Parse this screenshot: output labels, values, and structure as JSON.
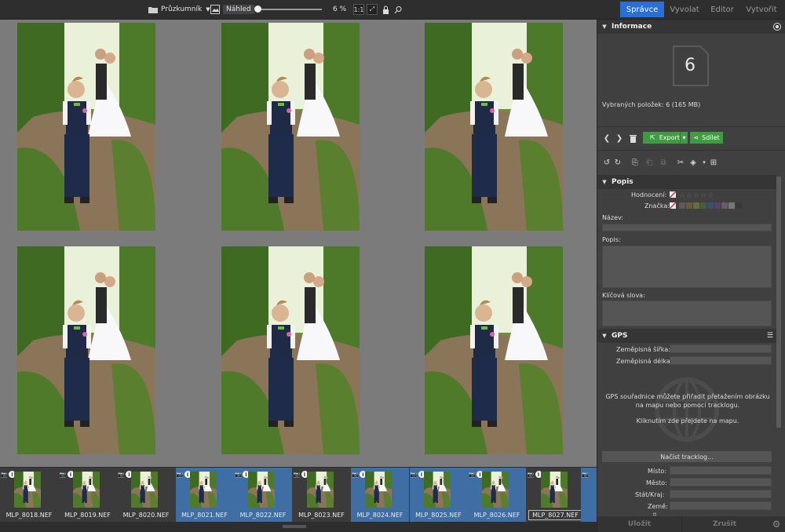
{
  "toolbar": {
    "explorer_label": "Průzkumník",
    "preview_label": "Náhled",
    "zoom_value": "6 %",
    "zoom_fraction": 0.05
  },
  "mode_tabs": [
    {
      "label": "Správce",
      "active": true
    },
    {
      "label": "Vyvolat",
      "active": false
    },
    {
      "label": "Editor",
      "active": false
    },
    {
      "label": "Vytvořit",
      "active": false
    }
  ],
  "filmstrip": [
    {
      "name": "MLP_8018.NEF",
      "selected": false
    },
    {
      "name": "MLP_8019.NEF",
      "selected": false
    },
    {
      "name": "MLP_8020.NEF",
      "selected": false
    },
    {
      "name": "MLP_8021.NEF",
      "selected": true
    },
    {
      "name": "MLP_8022.NEF",
      "selected": true
    },
    {
      "name": "MLP_8023.NEF",
      "selected": false
    },
    {
      "name": "MLP_8024.NEF",
      "selected": true
    },
    {
      "name": "MLP_8025.NEF",
      "selected": true
    },
    {
      "name": "MLP_8026.NEF",
      "selected": true
    },
    {
      "name": "MLP_8027.NEF",
      "selected": false,
      "current": true
    }
  ],
  "info": {
    "title": "Informace",
    "count": "6",
    "selected_text": "Vybraných položek: 6 (165 MB)",
    "export_label": "Export",
    "share_label": "Sdílet"
  },
  "popis": {
    "title": "Popis",
    "rating_label": "Hodnocení:",
    "tag_label": "Značka:",
    "name_label": "Název:",
    "desc_label": "Popis:",
    "keywords_label": "Klíčová slova:",
    "tag_colors": [
      "#5a5a5a",
      "#6b5a3a",
      "#6b6a3a",
      "#3f5f3f",
      "#3a4f6b",
      "#5a3f6b",
      "#6b5a6b",
      "#777777",
      "#3a3a3a"
    ]
  },
  "gps": {
    "title": "GPS",
    "lat_label": "Zeměpisná šířka:",
    "lon_label": "Zeměpisná délka:",
    "hint": "GPS souřadnice můžete přiřadit přetažením obrázku na mapu nebo pomocí tracklogu.",
    "click_hint": "Kliknutím zde přejdete na mapu.",
    "tracklog_button": "Načíst tracklog...",
    "place_label": "Místo:",
    "city_label": "Město:",
    "state_label": "Stát/Kraj:",
    "country_label": "Země:"
  },
  "bottom": {
    "save_label": "Uložit",
    "cancel_label": "Zrušit"
  }
}
